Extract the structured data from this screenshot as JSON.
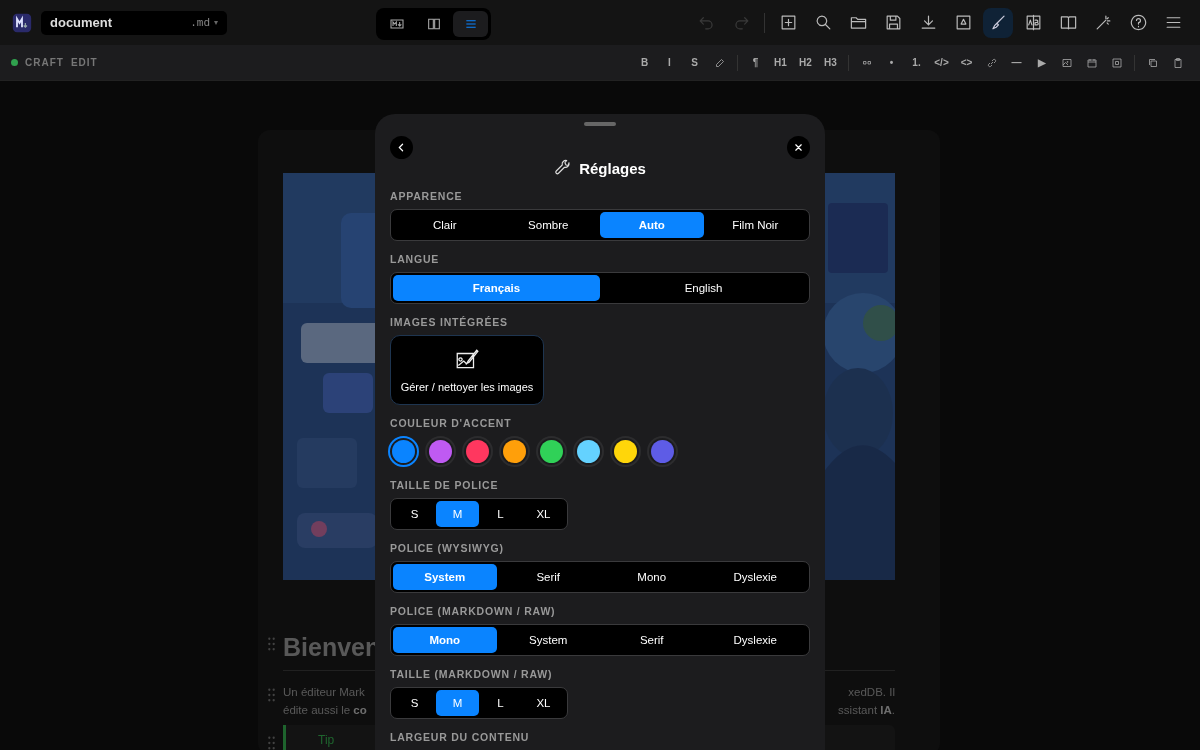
{
  "app_bar": {
    "file_name": "document",
    "extension": ".md",
    "caret": "▾",
    "view_modes": [
      {
        "selected": false
      },
      {
        "selected": false
      },
      {
        "selected": true
      }
    ],
    "tools": [
      {
        "disabled": true,
        "selected": false
      },
      {
        "disabled": true,
        "selected": false
      },
      {
        "disabled": false,
        "selected": false
      },
      {
        "disabled": false,
        "selected": false
      },
      {
        "disabled": false,
        "selected": false
      },
      {
        "disabled": false,
        "selected": false
      },
      {
        "disabled": false,
        "selected": false
      },
      {
        "disabled": false,
        "selected": false
      },
      {
        "disabled": false,
        "selected": true
      },
      {
        "disabled": false,
        "selected": false
      },
      {
        "disabled": false,
        "selected": false
      },
      {
        "disabled": false,
        "selected": false
      },
      {
        "disabled": false,
        "selected": false
      },
      {
        "disabled": false,
        "selected": false
      }
    ]
  },
  "format_bar": {
    "mode_label": "CRAFT",
    "mode_sub": "EDIT",
    "items": [
      {
        "kind": "text",
        "label": "B"
      },
      {
        "kind": "text",
        "label": "I"
      },
      {
        "kind": "text",
        "label": "S"
      },
      {
        "kind": "icon"
      },
      {
        "kind": "sep"
      },
      {
        "kind": "text",
        "label": "¶"
      },
      {
        "kind": "text",
        "label": "H1"
      },
      {
        "kind": "text",
        "label": "H2"
      },
      {
        "kind": "text",
        "label": "H3"
      },
      {
        "kind": "sep"
      },
      {
        "kind": "icon"
      },
      {
        "kind": "text",
        "label": "•"
      },
      {
        "kind": "text",
        "label": "1."
      },
      {
        "kind": "text",
        "label": "</>"
      },
      {
        "kind": "text",
        "label": "<>"
      },
      {
        "kind": "icon"
      },
      {
        "kind": "text",
        "label": "—"
      },
      {
        "kind": "text",
        "label": "▶"
      },
      {
        "kind": "icon"
      },
      {
        "kind": "icon"
      },
      {
        "kind": "icon"
      },
      {
        "kind": "sep"
      },
      {
        "kind": "icon"
      },
      {
        "kind": "icon"
      }
    ]
  },
  "document": {
    "heading": "Bienven",
    "paragraph_lines": [
      {
        "left": "Un éditeur Mark",
        "right": "xedDB. Il"
      },
      {
        "left": "édite aussi le **co**",
        "right": "ssistant **IA**."
      }
    ],
    "callout": "Tip"
  },
  "settings": {
    "title": "Réglages",
    "sections": [
      {
        "kind": "segmented",
        "title": "APPARENCE",
        "options": [
          {
            "label": "Clair",
            "selected": false
          },
          {
            "label": "Sombre",
            "selected": false
          },
          {
            "label": "Auto",
            "selected": true
          },
          {
            "label": "Film Noir",
            "selected": false
          }
        ]
      },
      {
        "kind": "segmented",
        "title": "LANGUE",
        "options": [
          {
            "label": "Français",
            "selected": true
          },
          {
            "label": "English",
            "selected": false
          }
        ]
      },
      {
        "kind": "button",
        "title": "IMAGES INTÉGRÉES",
        "button": "Gérer / nettoyer les images"
      },
      {
        "kind": "swatches",
        "title": "COULEUR D'ACCENT",
        "colors": [
          {
            "color": "#0a84ff",
            "selected": true
          },
          {
            "color": "#bf5af2",
            "selected": false
          },
          {
            "color": "#ff375f",
            "selected": false
          },
          {
            "color": "#ff9f0a",
            "selected": false
          },
          {
            "color": "#30d158",
            "selected": false
          },
          {
            "color": "#64d2ff",
            "selected": false
          },
          {
            "color": "#ffd60a",
            "selected": false
          },
          {
            "color": "#5e5ce6",
            "selected": false
          }
        ]
      },
      {
        "kind": "compact",
        "title": "TAILLE DE POLICE",
        "options": [
          {
            "label": "S",
            "selected": false
          },
          {
            "label": "M",
            "selected": true
          },
          {
            "label": "L",
            "selected": false
          },
          {
            "label": "XL",
            "selected": false
          }
        ]
      },
      {
        "kind": "segmented",
        "title": "POLICE (WYSIWYG)",
        "options": [
          {
            "label": "System",
            "selected": true
          },
          {
            "label": "Serif",
            "selected": false
          },
          {
            "label": "Mono",
            "selected": false
          },
          {
            "label": "Dyslexie",
            "selected": false
          }
        ]
      },
      {
        "kind": "segmented",
        "title": "POLICE (MARKDOWN / RAW)",
        "options": [
          {
            "label": "Mono",
            "selected": true
          },
          {
            "label": "System",
            "selected": false
          },
          {
            "label": "Serif",
            "selected": false
          },
          {
            "label": "Dyslexie",
            "selected": false
          }
        ]
      },
      {
        "kind": "compact",
        "title": "TAILLE (MARKDOWN / RAW)",
        "options": [
          {
            "label": "S",
            "selected": false
          },
          {
            "label": "M",
            "selected": true
          },
          {
            "label": "L",
            "selected": false
          },
          {
            "label": "XL",
            "selected": false
          }
        ]
      },
      {
        "kind": "heading",
        "title": "LARGEUR DU CONTENU"
      }
    ]
  }
}
